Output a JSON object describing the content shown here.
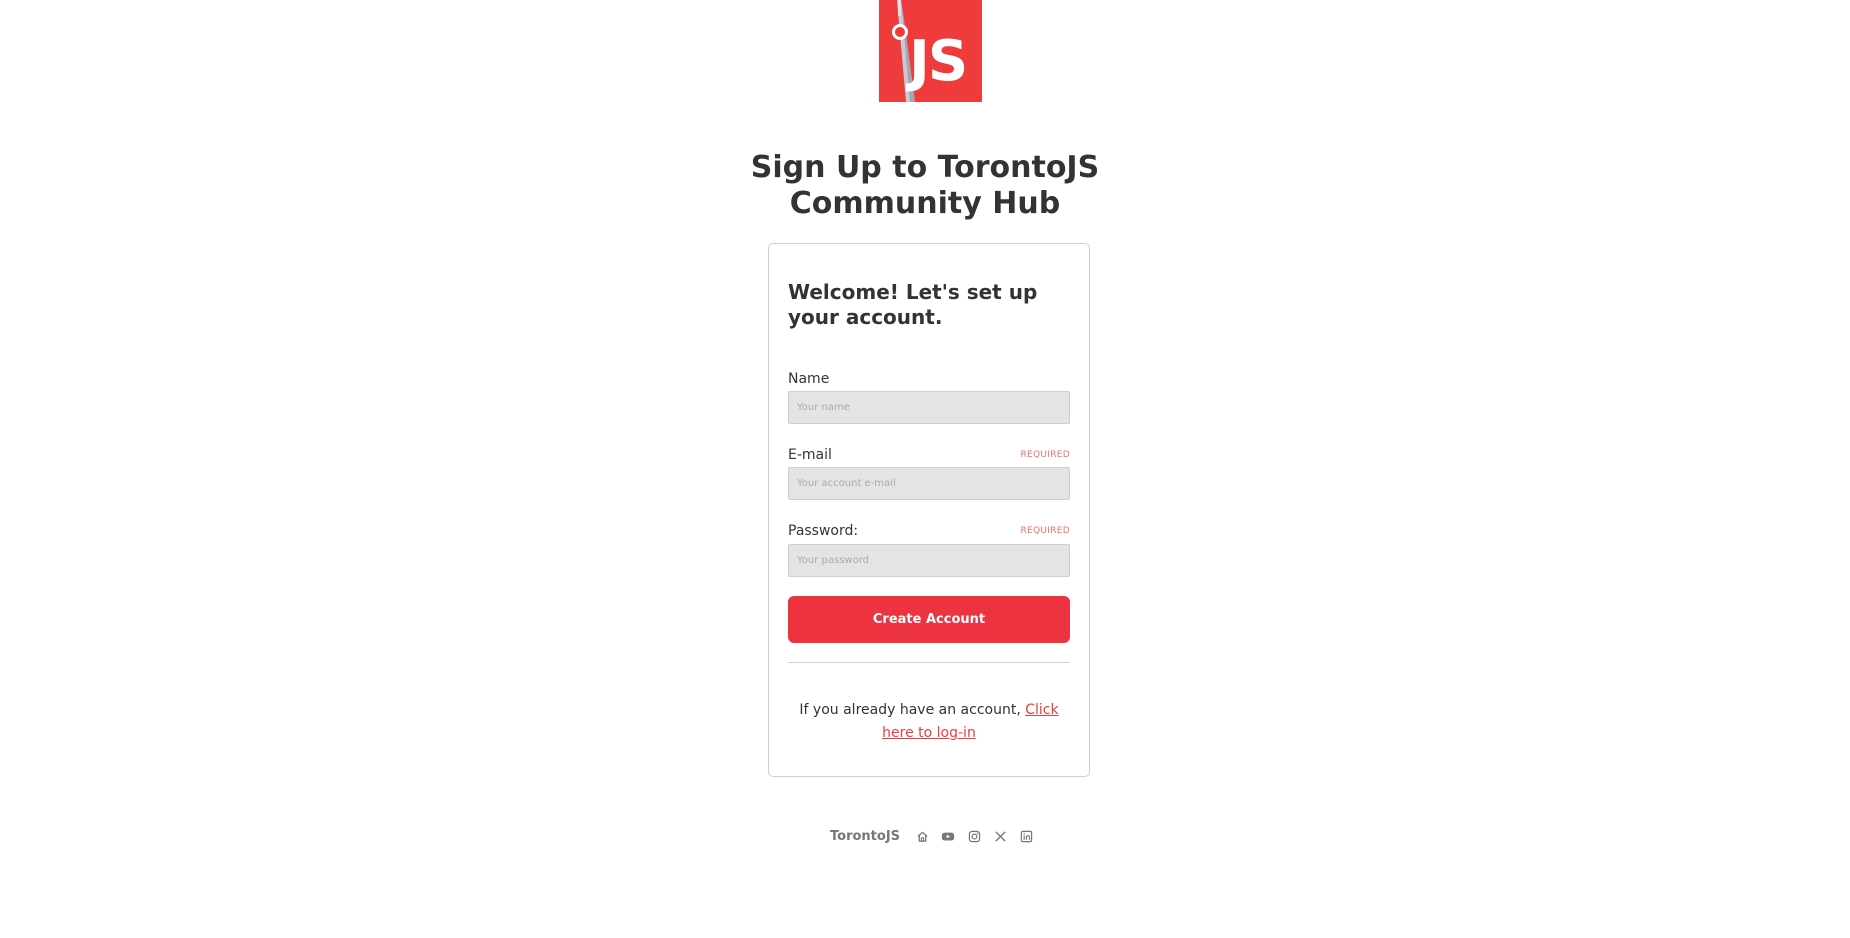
{
  "logo": {
    "text": "JS",
    "icon": "cn-tower-logo",
    "color": "#ee3b3b"
  },
  "page_title": "Sign Up to TorontoJS Community Hub",
  "form": {
    "welcome": "Welcome! Let's set up your account.",
    "fields": [
      {
        "label": "Name",
        "placeholder": "Your name",
        "value": "",
        "required": ""
      },
      {
        "label": "E-mail",
        "placeholder": "Your account e-mail",
        "value": "",
        "required": "REQUIRED"
      },
      {
        "label": "Password:",
        "placeholder": "Your password",
        "value": "",
        "required": "REQUIRED"
      }
    ],
    "submit_label": "Create Account",
    "submit_color": "#ed3240",
    "login_prompt": "If you already have an account,",
    "login_link": "Click here to log-in"
  },
  "footer": {
    "brand": "TorontoJS",
    "icons": [
      "home-icon",
      "youtube-icon",
      "instagram-icon",
      "x-icon",
      "linkedin-icon"
    ]
  }
}
